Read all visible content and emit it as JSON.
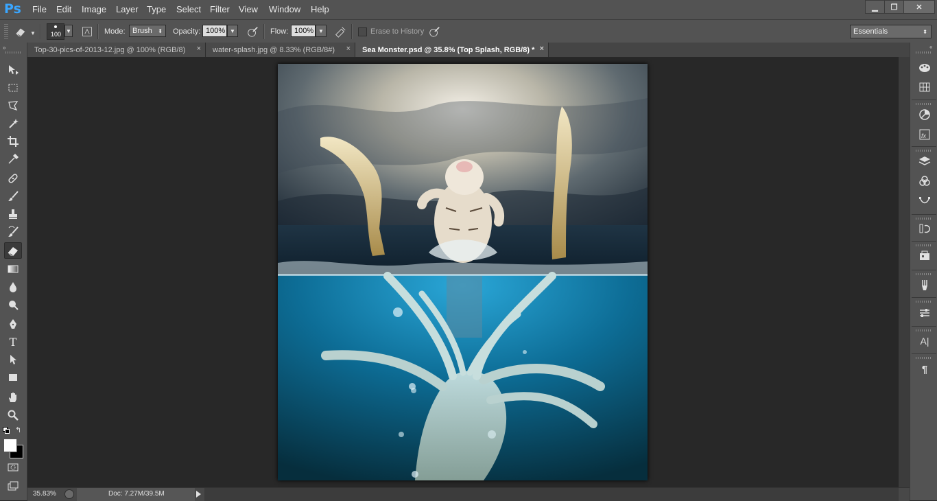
{
  "app": {
    "logo": "Ps"
  },
  "menu": [
    "File",
    "Edit",
    "Image",
    "Layer",
    "Type",
    "Select",
    "Filter",
    "View",
    "Window",
    "Help"
  ],
  "window_controls": {
    "minimize": "▁",
    "restore": "❐",
    "close": "✕"
  },
  "options": {
    "brush_size": "100",
    "mode_label": "Mode:",
    "mode_value": "Brush",
    "opacity_label": "Opacity:",
    "opacity_value": "100%",
    "flow_label": "Flow:",
    "flow_value": "100%",
    "erase_history_label": "Erase to History",
    "workspace_value": "Essentials"
  },
  "tabs": [
    {
      "label": "Top-30-pics-of-2013-12.jpg @ 100% (RGB/8)",
      "active": false
    },
    {
      "label": "water-splash.jpg @ 8.33% (RGB/8#)",
      "active": false
    },
    {
      "label": "Sea Monster.psd @ 35.8% (Top Splash, RGB/8) *",
      "active": true
    }
  ],
  "tab_close_glyph": "×",
  "status": {
    "zoom": "35.83%",
    "doc": "Doc: 7.27M/39.5M"
  },
  "colors": {
    "accent": "#3aa6ff",
    "chrome": "#535353",
    "workspace": "#282828"
  },
  "tools": [
    "move-tool",
    "marquee-tool",
    "lasso-tool",
    "magic-wand-tool",
    "crop-tool",
    "eyedropper-tool",
    "healing-brush-tool",
    "brush-tool",
    "clone-stamp-tool",
    "history-brush-tool",
    "eraser-tool",
    "gradient-tool",
    "blur-tool",
    "dodge-tool",
    "pen-tool",
    "type-tool",
    "path-selection-tool",
    "rectangle-tool",
    "hand-tool",
    "zoom-tool"
  ],
  "active_tool": "eraser-tool",
  "type_tool_glyph": "T",
  "panels": [
    "color-panel",
    "swatches-panel",
    "adjustments-panel",
    "styles-panel",
    "layers-panel",
    "channels-panel",
    "paths-panel",
    "history-panel",
    "properties-panel",
    "brush-panel",
    "brush-presets-panel",
    "character-panel",
    "paragraph-panel"
  ],
  "character_glyph": "A|",
  "paragraph_glyph": "¶"
}
